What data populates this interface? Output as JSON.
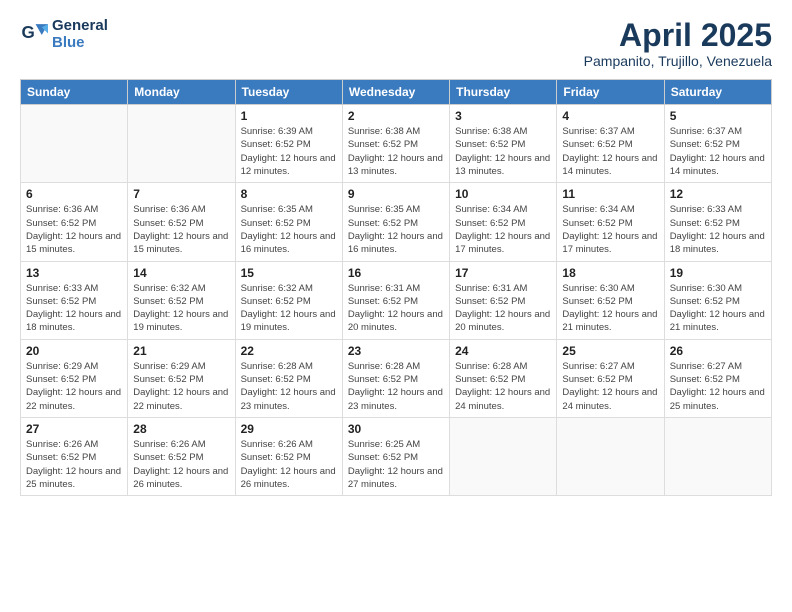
{
  "logo": {
    "line1": "General",
    "line2": "Blue"
  },
  "title": "April 2025",
  "location": "Pampanito, Trujillo, Venezuela",
  "days_of_week": [
    "Sunday",
    "Monday",
    "Tuesday",
    "Wednesday",
    "Thursday",
    "Friday",
    "Saturday"
  ],
  "weeks": [
    [
      {
        "day": "",
        "info": ""
      },
      {
        "day": "",
        "info": ""
      },
      {
        "day": "1",
        "info": "Sunrise: 6:39 AM\nSunset: 6:52 PM\nDaylight: 12 hours and 12 minutes."
      },
      {
        "day": "2",
        "info": "Sunrise: 6:38 AM\nSunset: 6:52 PM\nDaylight: 12 hours and 13 minutes."
      },
      {
        "day": "3",
        "info": "Sunrise: 6:38 AM\nSunset: 6:52 PM\nDaylight: 12 hours and 13 minutes."
      },
      {
        "day": "4",
        "info": "Sunrise: 6:37 AM\nSunset: 6:52 PM\nDaylight: 12 hours and 14 minutes."
      },
      {
        "day": "5",
        "info": "Sunrise: 6:37 AM\nSunset: 6:52 PM\nDaylight: 12 hours and 14 minutes."
      }
    ],
    [
      {
        "day": "6",
        "info": "Sunrise: 6:36 AM\nSunset: 6:52 PM\nDaylight: 12 hours and 15 minutes."
      },
      {
        "day": "7",
        "info": "Sunrise: 6:36 AM\nSunset: 6:52 PM\nDaylight: 12 hours and 15 minutes."
      },
      {
        "day": "8",
        "info": "Sunrise: 6:35 AM\nSunset: 6:52 PM\nDaylight: 12 hours and 16 minutes."
      },
      {
        "day": "9",
        "info": "Sunrise: 6:35 AM\nSunset: 6:52 PM\nDaylight: 12 hours and 16 minutes."
      },
      {
        "day": "10",
        "info": "Sunrise: 6:34 AM\nSunset: 6:52 PM\nDaylight: 12 hours and 17 minutes."
      },
      {
        "day": "11",
        "info": "Sunrise: 6:34 AM\nSunset: 6:52 PM\nDaylight: 12 hours and 17 minutes."
      },
      {
        "day": "12",
        "info": "Sunrise: 6:33 AM\nSunset: 6:52 PM\nDaylight: 12 hours and 18 minutes."
      }
    ],
    [
      {
        "day": "13",
        "info": "Sunrise: 6:33 AM\nSunset: 6:52 PM\nDaylight: 12 hours and 18 minutes."
      },
      {
        "day": "14",
        "info": "Sunrise: 6:32 AM\nSunset: 6:52 PM\nDaylight: 12 hours and 19 minutes."
      },
      {
        "day": "15",
        "info": "Sunrise: 6:32 AM\nSunset: 6:52 PM\nDaylight: 12 hours and 19 minutes."
      },
      {
        "day": "16",
        "info": "Sunrise: 6:31 AM\nSunset: 6:52 PM\nDaylight: 12 hours and 20 minutes."
      },
      {
        "day": "17",
        "info": "Sunrise: 6:31 AM\nSunset: 6:52 PM\nDaylight: 12 hours and 20 minutes."
      },
      {
        "day": "18",
        "info": "Sunrise: 6:30 AM\nSunset: 6:52 PM\nDaylight: 12 hours and 21 minutes."
      },
      {
        "day": "19",
        "info": "Sunrise: 6:30 AM\nSunset: 6:52 PM\nDaylight: 12 hours and 21 minutes."
      }
    ],
    [
      {
        "day": "20",
        "info": "Sunrise: 6:29 AM\nSunset: 6:52 PM\nDaylight: 12 hours and 22 minutes."
      },
      {
        "day": "21",
        "info": "Sunrise: 6:29 AM\nSunset: 6:52 PM\nDaylight: 12 hours and 22 minutes."
      },
      {
        "day": "22",
        "info": "Sunrise: 6:28 AM\nSunset: 6:52 PM\nDaylight: 12 hours and 23 minutes."
      },
      {
        "day": "23",
        "info": "Sunrise: 6:28 AM\nSunset: 6:52 PM\nDaylight: 12 hours and 23 minutes."
      },
      {
        "day": "24",
        "info": "Sunrise: 6:28 AM\nSunset: 6:52 PM\nDaylight: 12 hours and 24 minutes."
      },
      {
        "day": "25",
        "info": "Sunrise: 6:27 AM\nSunset: 6:52 PM\nDaylight: 12 hours and 24 minutes."
      },
      {
        "day": "26",
        "info": "Sunrise: 6:27 AM\nSunset: 6:52 PM\nDaylight: 12 hours and 25 minutes."
      }
    ],
    [
      {
        "day": "27",
        "info": "Sunrise: 6:26 AM\nSunset: 6:52 PM\nDaylight: 12 hours and 25 minutes."
      },
      {
        "day": "28",
        "info": "Sunrise: 6:26 AM\nSunset: 6:52 PM\nDaylight: 12 hours and 26 minutes."
      },
      {
        "day": "29",
        "info": "Sunrise: 6:26 AM\nSunset: 6:52 PM\nDaylight: 12 hours and 26 minutes."
      },
      {
        "day": "30",
        "info": "Sunrise: 6:25 AM\nSunset: 6:52 PM\nDaylight: 12 hours and 27 minutes."
      },
      {
        "day": "",
        "info": ""
      },
      {
        "day": "",
        "info": ""
      },
      {
        "day": "",
        "info": ""
      }
    ]
  ]
}
